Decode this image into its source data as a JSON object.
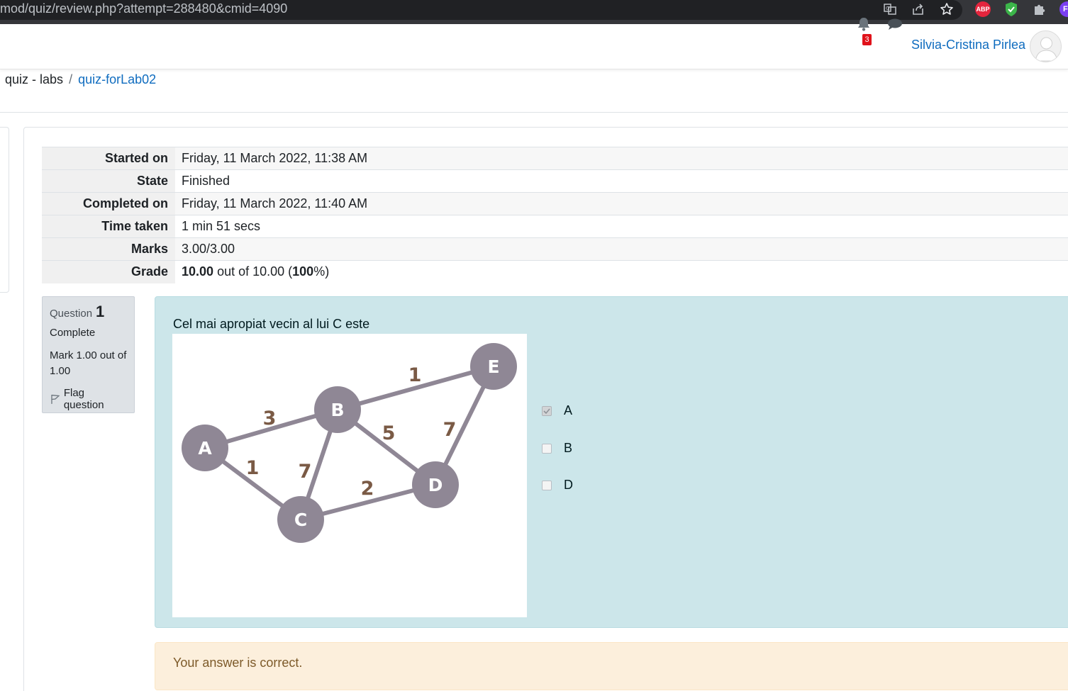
{
  "browser": {
    "url": "mod/quiz/review.php?attempt=288480&cmid=4090",
    "extension_abp": "ABP",
    "profile_initial": "F"
  },
  "navbar": {
    "notification_count": "3",
    "username": "Silvia-Cristina Pirlea"
  },
  "breadcrumb": {
    "items": [
      "quiz - labs",
      "quiz-forLab02"
    ]
  },
  "summary": {
    "rows": [
      {
        "label": "Started on",
        "value": "Friday, 11 March 2022, 11:38 AM"
      },
      {
        "label": "State",
        "value": "Finished"
      },
      {
        "label": "Completed on",
        "value": "Friday, 11 March 2022, 11:40 AM"
      },
      {
        "label": "Time taken",
        "value": "1 min 51 secs"
      },
      {
        "label": "Marks",
        "value": "3.00/3.00"
      }
    ],
    "grade": {
      "label": "Grade",
      "score": "10.00",
      "out_of": "out of 10.00",
      "percent": "100",
      "percent_suffix": "%"
    }
  },
  "question": {
    "word": "Question",
    "number": "1",
    "state": "Complete",
    "mark": "Mark 1.00 out of 1.00",
    "flag_label": "Flag question",
    "text": "Cel mai apropiat vecin al lui C este",
    "graph": {
      "nodes": [
        "A",
        "B",
        "C",
        "D",
        "E"
      ],
      "edges": [
        {
          "from": "A",
          "to": "B",
          "weight": "3"
        },
        {
          "from": "A",
          "to": "C",
          "weight": "1"
        },
        {
          "from": "B",
          "to": "C",
          "weight": "7"
        },
        {
          "from": "B",
          "to": "D",
          "weight": "5"
        },
        {
          "from": "B",
          "to": "E",
          "weight": "1"
        },
        {
          "from": "C",
          "to": "D",
          "weight": "2"
        },
        {
          "from": "D",
          "to": "E",
          "weight": "7"
        }
      ]
    },
    "options": [
      {
        "label": "A",
        "checked": true
      },
      {
        "label": "B",
        "checked": false
      },
      {
        "label": "D",
        "checked": false
      }
    ],
    "feedback": "Your answer is correct."
  },
  "colors": {
    "link": "#0f6cbf",
    "formulation_bg": "#cce6ea",
    "feedback_bg": "#fcefdc",
    "node_fill": "#8f8795",
    "weight_label": "#7a5a45"
  }
}
